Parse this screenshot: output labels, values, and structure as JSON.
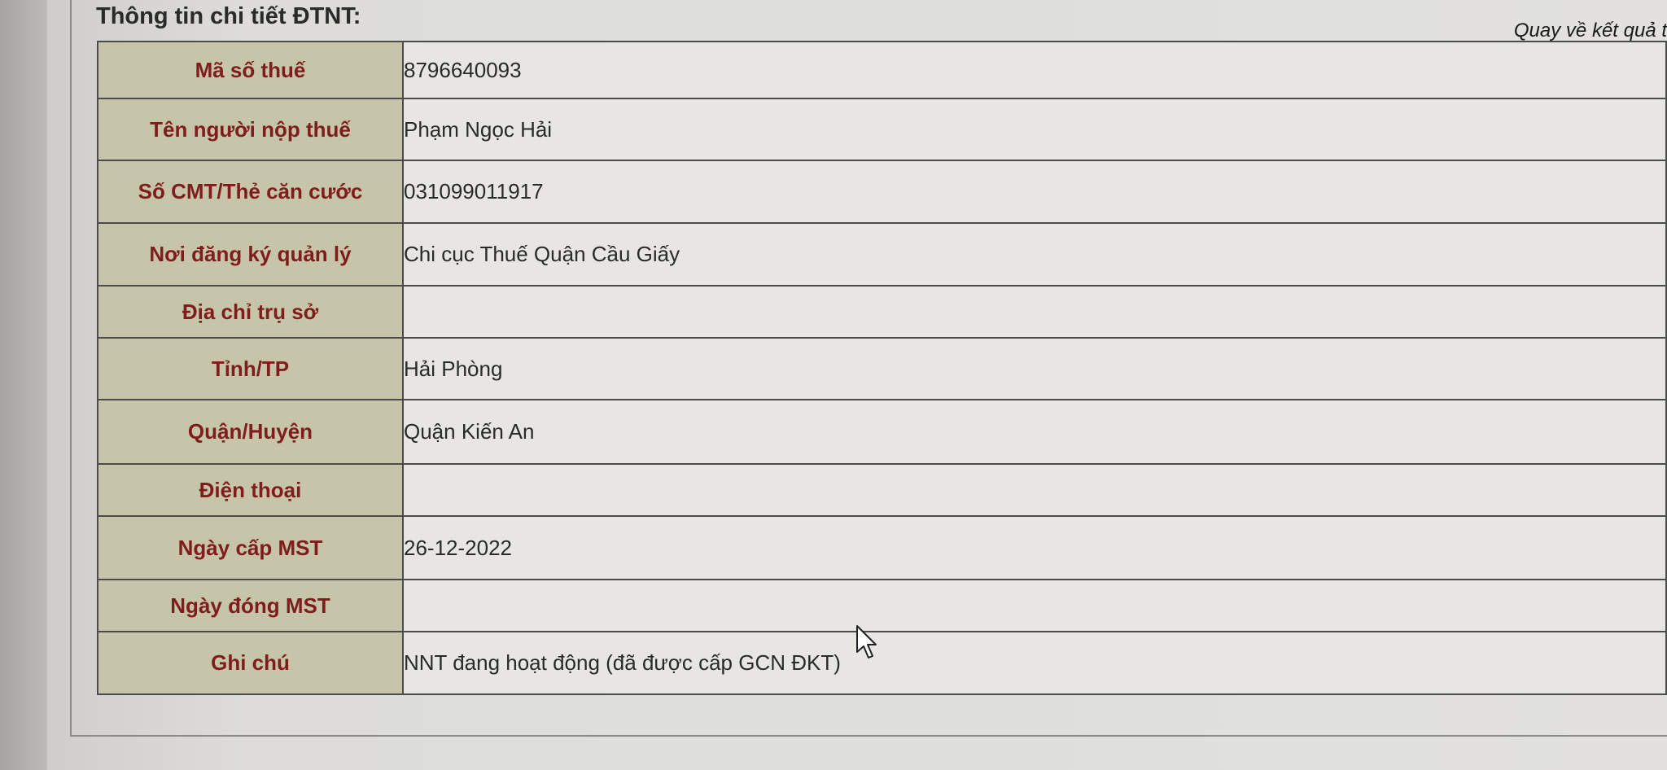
{
  "page": {
    "title": "Thông tin chi tiết ĐTNT:",
    "back_link": "Quay về kết quả t"
  },
  "details": {
    "rows": [
      {
        "label": "Mã số thuế",
        "value": "8796640093"
      },
      {
        "label": "Tên người nộp thuế",
        "value": "Phạm Ngọc Hải"
      },
      {
        "label": "Số CMT/Thẻ căn cước",
        "value": "031099011917"
      },
      {
        "label": "Nơi đăng ký quản lý",
        "value": "Chi cục Thuế Quận Cầu Giấy"
      },
      {
        "label": "Địa chỉ trụ sở",
        "value": ""
      },
      {
        "label": "Tỉnh/TP",
        "value": "Hải Phòng"
      },
      {
        "label": "Quận/Huyện",
        "value": "Quận Kiến An"
      },
      {
        "label": "Điện thoại",
        "value": ""
      },
      {
        "label": "Ngày cấp MST",
        "value": "26-12-2022"
      },
      {
        "label": "Ngày đóng MST",
        "value": ""
      },
      {
        "label": "Ghi chú",
        "value": "NNT đang hoạt động (đã được cấp GCN ĐKT)"
      }
    ]
  },
  "colors": {
    "label_bg": "#c6c4a9",
    "label_text": "#7f1d1d",
    "value_bg": "#e7e6e3",
    "border": "#4b4b4b"
  },
  "icons": {
    "cursor": "mouse-pointer-icon"
  }
}
